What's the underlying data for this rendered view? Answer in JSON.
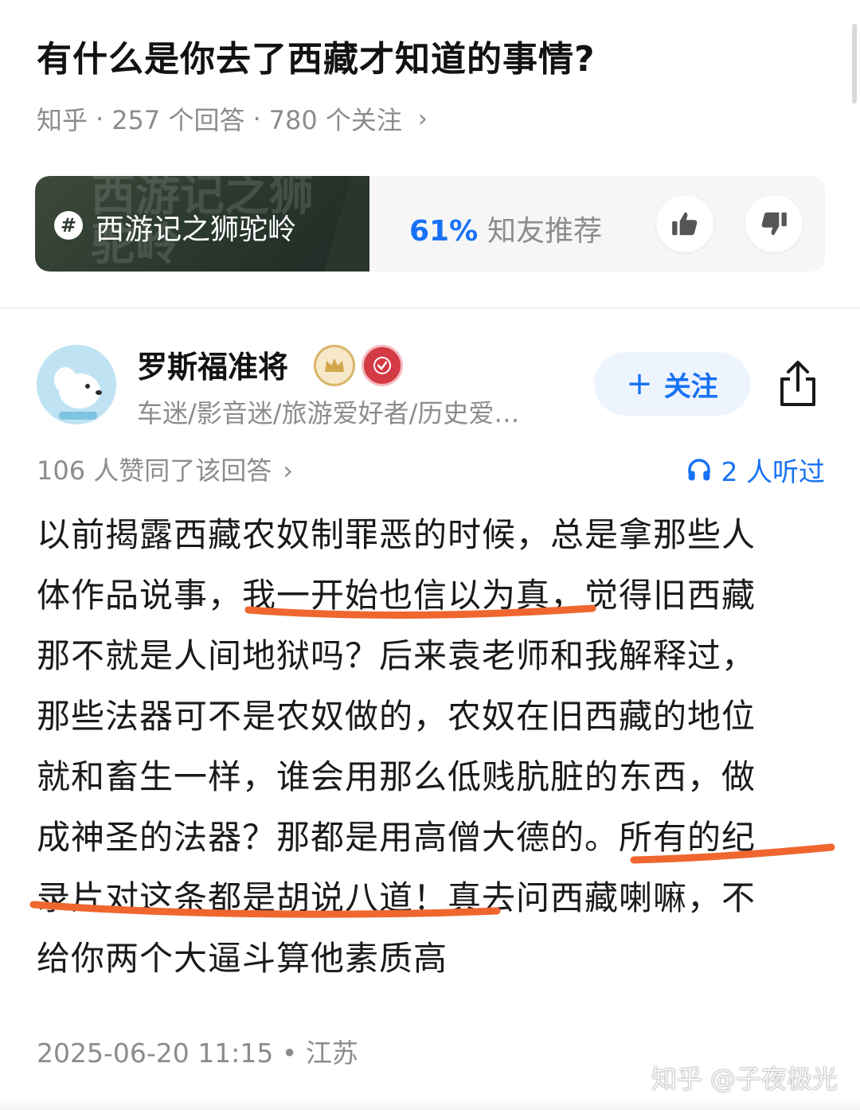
{
  "question": {
    "title": "有什么是你去了西藏才知道的事情?",
    "source": "知乎",
    "answers": "257 个回答",
    "followers": "780 个关注",
    "chevron": "›"
  },
  "topic": {
    "label": "西游记之狮驼岭",
    "ghost_text": "西游记之狮驼岭",
    "badge": "#",
    "recommend_pct": "61%",
    "recommend_text": "知友推荐"
  },
  "author": {
    "name": "罗斯福准将",
    "tags": "车迷/影音迷/旅游爱好者/历史爱…",
    "follow_label": "关注",
    "follow_plus": "+"
  },
  "answer": {
    "agree": "106 人赞同了该回答",
    "agree_chevron": "›",
    "listen": "2 人听过",
    "lines": [
      "以前揭露西藏农奴制罪恶的时候，总是拿那些人",
      "体作品说事，我一开始也信以为真，觉得旧西藏",
      "那不就是人间地狱吗？后来袁老师和我解释过，",
      "那些法器可不是农奴做的，农奴在旧西藏的地位",
      "就和畜生一样，谁会用那么低贱肮脏的东西，做",
      "成神圣的法器？那都是用高僧大德的。所有的纪",
      "录片对这条都是胡说八道！真去问西藏喇嘛，不",
      "给你两个大逼斗算他素质高"
    ],
    "time": "2025-06-20 11:15",
    "location": "江苏"
  },
  "watermark": "知乎 @子夜极光",
  "colors": {
    "accent": "#1772f6",
    "muted": "#8c8c8c",
    "highlight_stroke": "#f0662f"
  },
  "icons": [
    "thumb-up-icon",
    "thumb-down-icon",
    "share-icon",
    "headphones-icon",
    "crown-badge-icon",
    "verified-badge-icon",
    "hashtag-icon"
  ]
}
